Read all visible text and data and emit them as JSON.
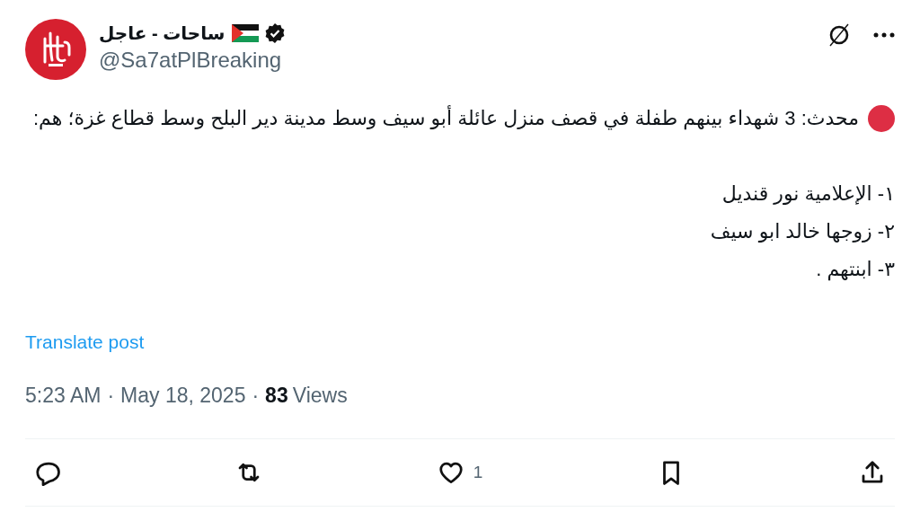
{
  "author": {
    "name": "ساحات - عاجل",
    "handle": "@Sa7atPlBreaking",
    "verified": true
  },
  "post": {
    "lead": "محدث: 3 شهداء بينهم طفلة في قصف منزل عائلة أبو سيف وسط مدينة دير البلح وسط قطاع غزة؛ هم:",
    "lines": [
      "١-  الإعلامية نور قنديل",
      "٢-  زوجها خالد ابو سيف",
      "٣- ابنتهم ."
    ],
    "translate": "Translate post"
  },
  "meta": {
    "time": "5:23 AM",
    "separator": "·",
    "date": "May 18, 2025",
    "separator_2": "·",
    "views_count": "83",
    "views_label": "Views"
  },
  "actions": [
    {
      "kind": "reply"
    },
    {
      "kind": "repost"
    },
    {
      "kind": "like",
      "count": "1"
    },
    {
      "kind": "bookmark"
    },
    {
      "kind": "share"
    }
  ]
}
